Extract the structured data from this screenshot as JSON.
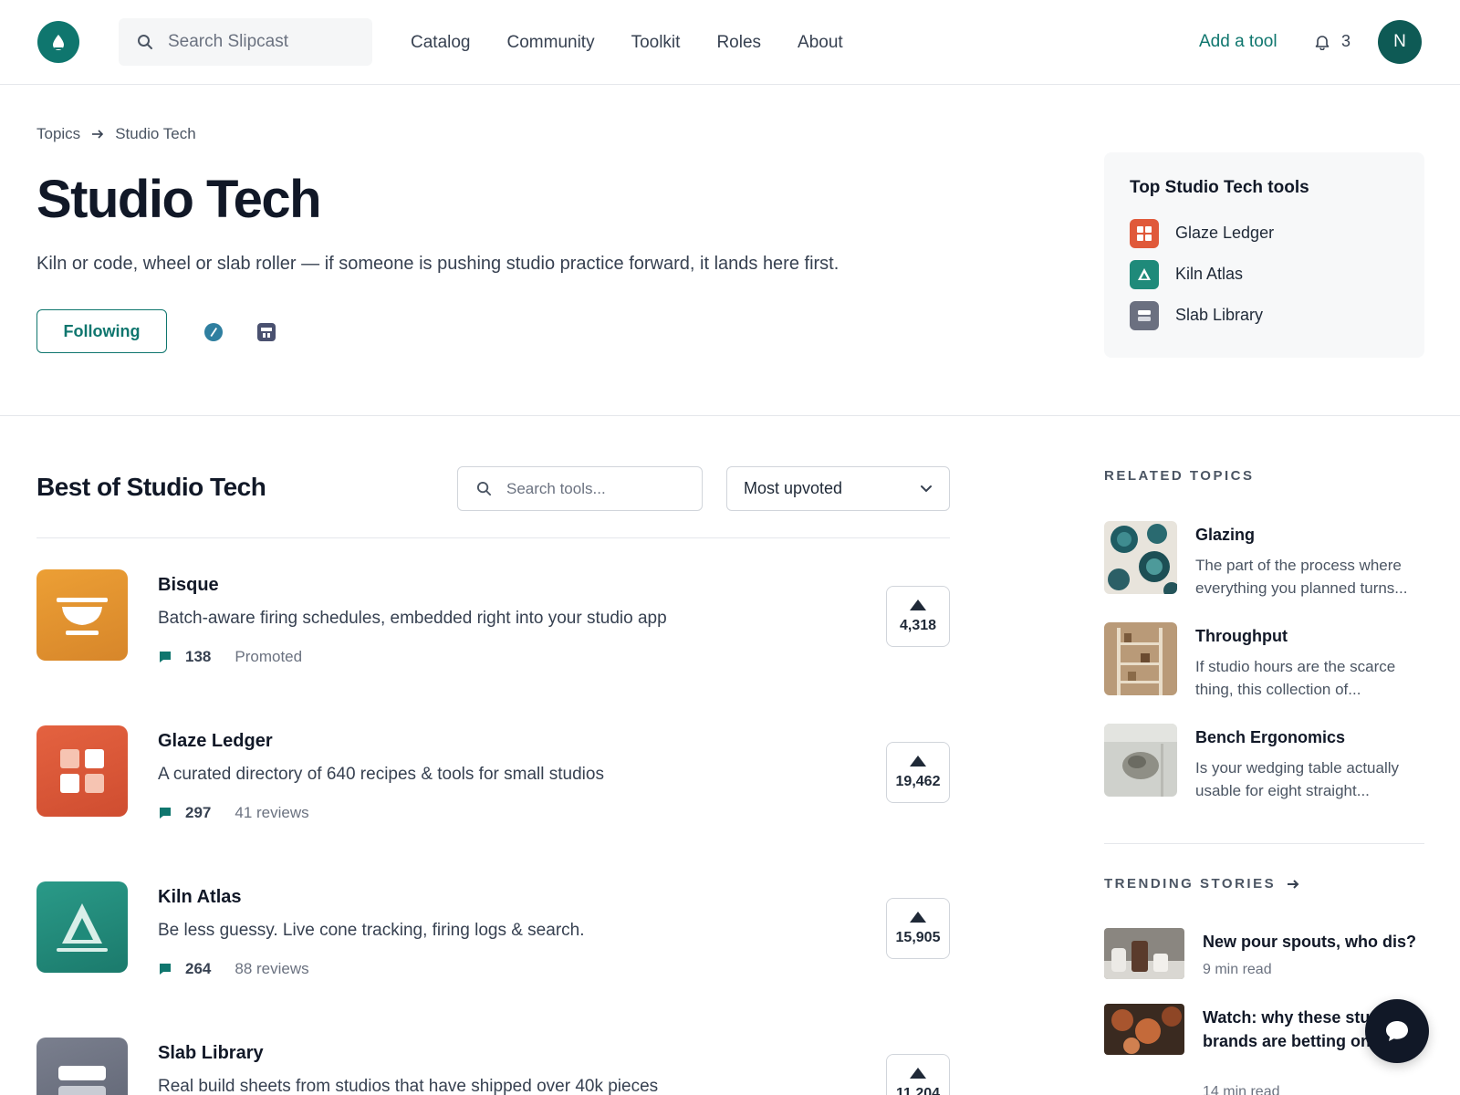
{
  "header": {
    "search_placeholder": "Search Slipcast",
    "nav": [
      "Catalog",
      "Community",
      "Toolkit",
      "Roles",
      "About"
    ],
    "add_tool": "Add a tool",
    "notification_count": "3",
    "avatar_initial": "N",
    "accent": "#0f766e"
  },
  "hero": {
    "breadcrumb": [
      "Topics",
      "Studio Tech"
    ],
    "title": "Studio Tech",
    "description": "Kiln or code, wheel or slab roller — if someone is pushing studio practice forward, it lands here first.",
    "follow_label": "Following",
    "icons": [
      "compass-icon",
      "storefront-icon"
    ]
  },
  "top_tools": {
    "title": "Top Studio Tech tools",
    "items": [
      {
        "label": "Glaze Ledger",
        "icon": "grid-icon",
        "color": "#e0593a"
      },
      {
        "label": "Kiln Atlas",
        "icon": "triangle-icon",
        "color": "#1f8a7a"
      },
      {
        "label": "Slab Library",
        "icon": "stack-icon",
        "color": "#6b7080"
      }
    ]
  },
  "best_of": {
    "title": "Best of Studio Tech",
    "search_placeholder": "Search tools...",
    "sort_selected": "Most upvoted",
    "tools": [
      {
        "name": "Bisque",
        "tagline": "Batch-aware firing schedules, embedded right into your studio app",
        "comments": "138",
        "extra": "Promoted",
        "votes": "4,318",
        "icon": "bowl-icon",
        "color": "#e39a2e"
      },
      {
        "name": "Glaze Ledger",
        "tagline": "A curated directory of 640 recipes & tools for small studios",
        "comments": "297",
        "extra": "41 reviews",
        "votes": "19,462",
        "icon": "grid-icon",
        "color": "#e0593a"
      },
      {
        "name": "Kiln Atlas",
        "tagline": "Be less guessy. Live cone tracking, firing logs & search.",
        "comments": "264",
        "extra": "88 reviews",
        "votes": "15,905",
        "icon": "triangle-icon",
        "color": "#1f8a7a"
      },
      {
        "name": "Slab Library",
        "tagline": "Real build sheets from studios that have shipped over 40k pieces",
        "comments": "",
        "extra": "",
        "votes": "11,204",
        "icon": "stack-icon",
        "color": "#6b7080"
      }
    ]
  },
  "sidebar": {
    "related_label": "RELATED TOPICS",
    "related": [
      {
        "name": "Glazing",
        "desc": "The part of the process where everything you planned turns..."
      },
      {
        "name": "Throughput",
        "desc": "If studio hours are the scarce thing, this collection of..."
      },
      {
        "name": "Bench Ergonomics",
        "desc": "Is your wedging table actually usable for eight straight..."
      }
    ],
    "trending_label": "TRENDING STORIES",
    "stories": [
      {
        "title": "New pour spouts, who dis?",
        "read": "9 min read"
      },
      {
        "title": "Watch: why these studio brands are betting on glaze",
        "read": "14 min read"
      }
    ]
  }
}
